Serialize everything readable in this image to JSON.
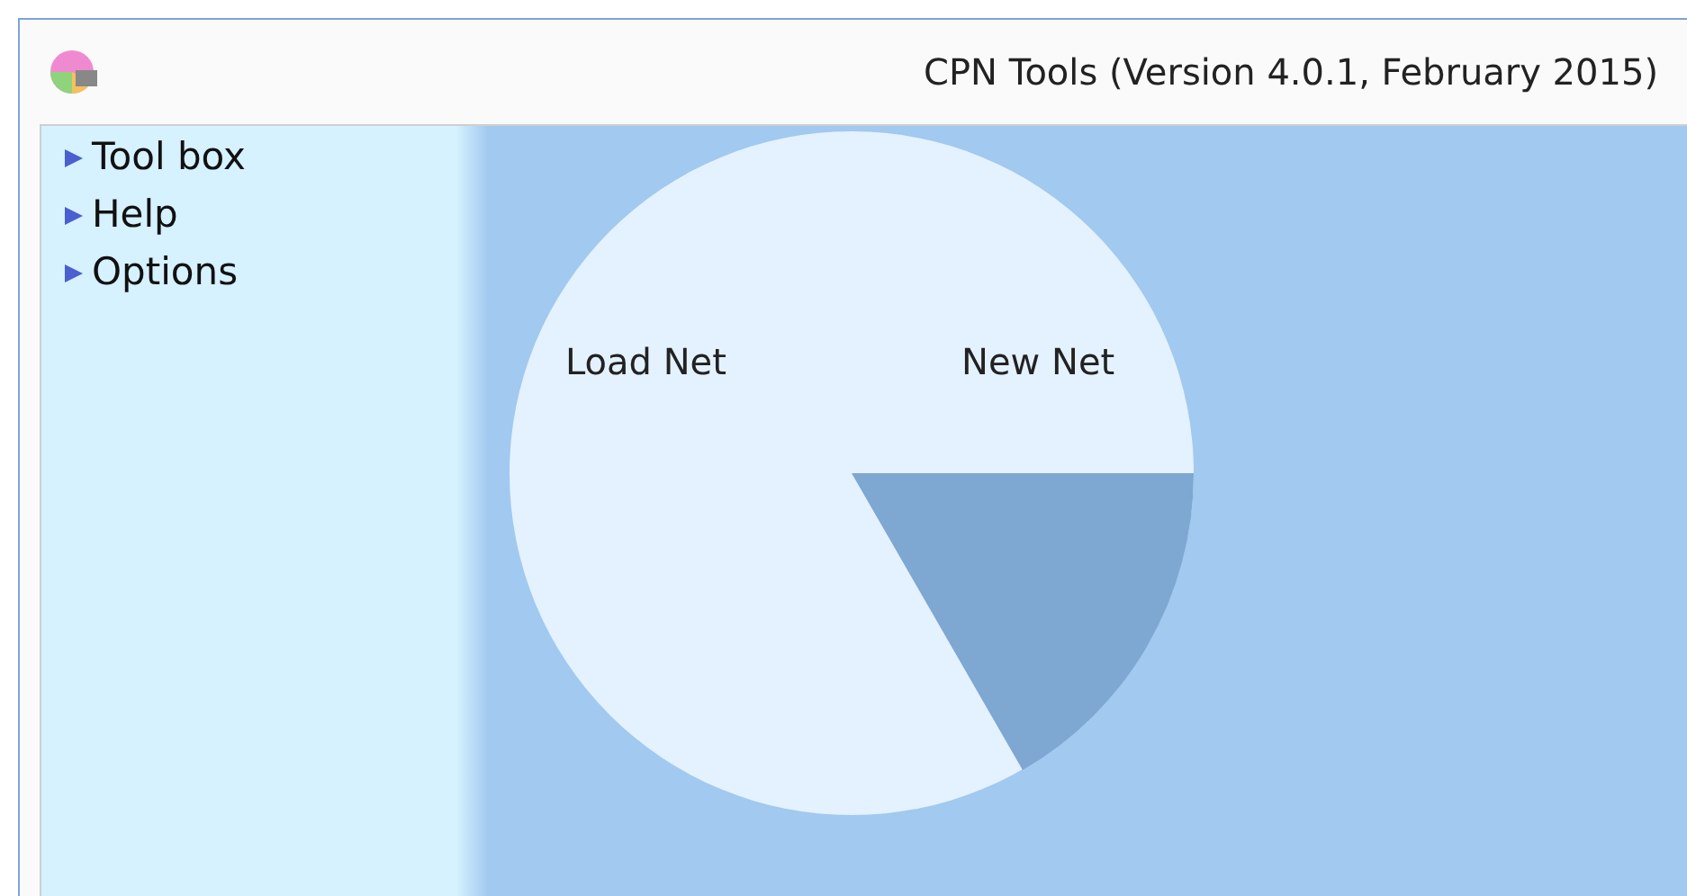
{
  "window": {
    "title": "CPN Tools (Version 4.0.1, February 2015)"
  },
  "sidebar": {
    "items": [
      {
        "label": "Tool box",
        "expanded": false
      },
      {
        "label": "Help",
        "expanded": false
      },
      {
        "label": "Options",
        "expanded": false
      }
    ]
  },
  "pie_menu": {
    "items": [
      {
        "label": "Load Net"
      },
      {
        "label": "New Net"
      }
    ]
  }
}
